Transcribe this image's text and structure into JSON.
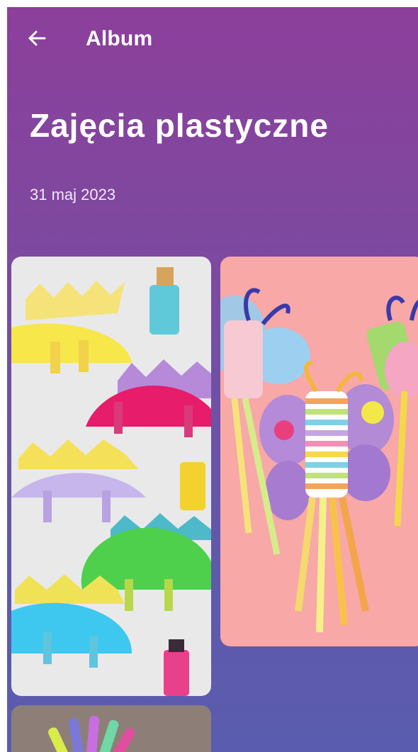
{
  "header": {
    "back_icon": "arrow-left-icon",
    "title": "Album"
  },
  "album": {
    "title": "Zajęcia plastyczne",
    "date": "31 maj 2023"
  },
  "photos": [
    {
      "subject": "paper plate dinosaurs"
    },
    {
      "subject": "butterfly windsocks"
    },
    {
      "subject": "handprint craft"
    }
  ],
  "colors": {
    "gradient_top": "#8c3f9b",
    "gradient_bottom": "#5a5caf",
    "text": "#ffffff"
  }
}
